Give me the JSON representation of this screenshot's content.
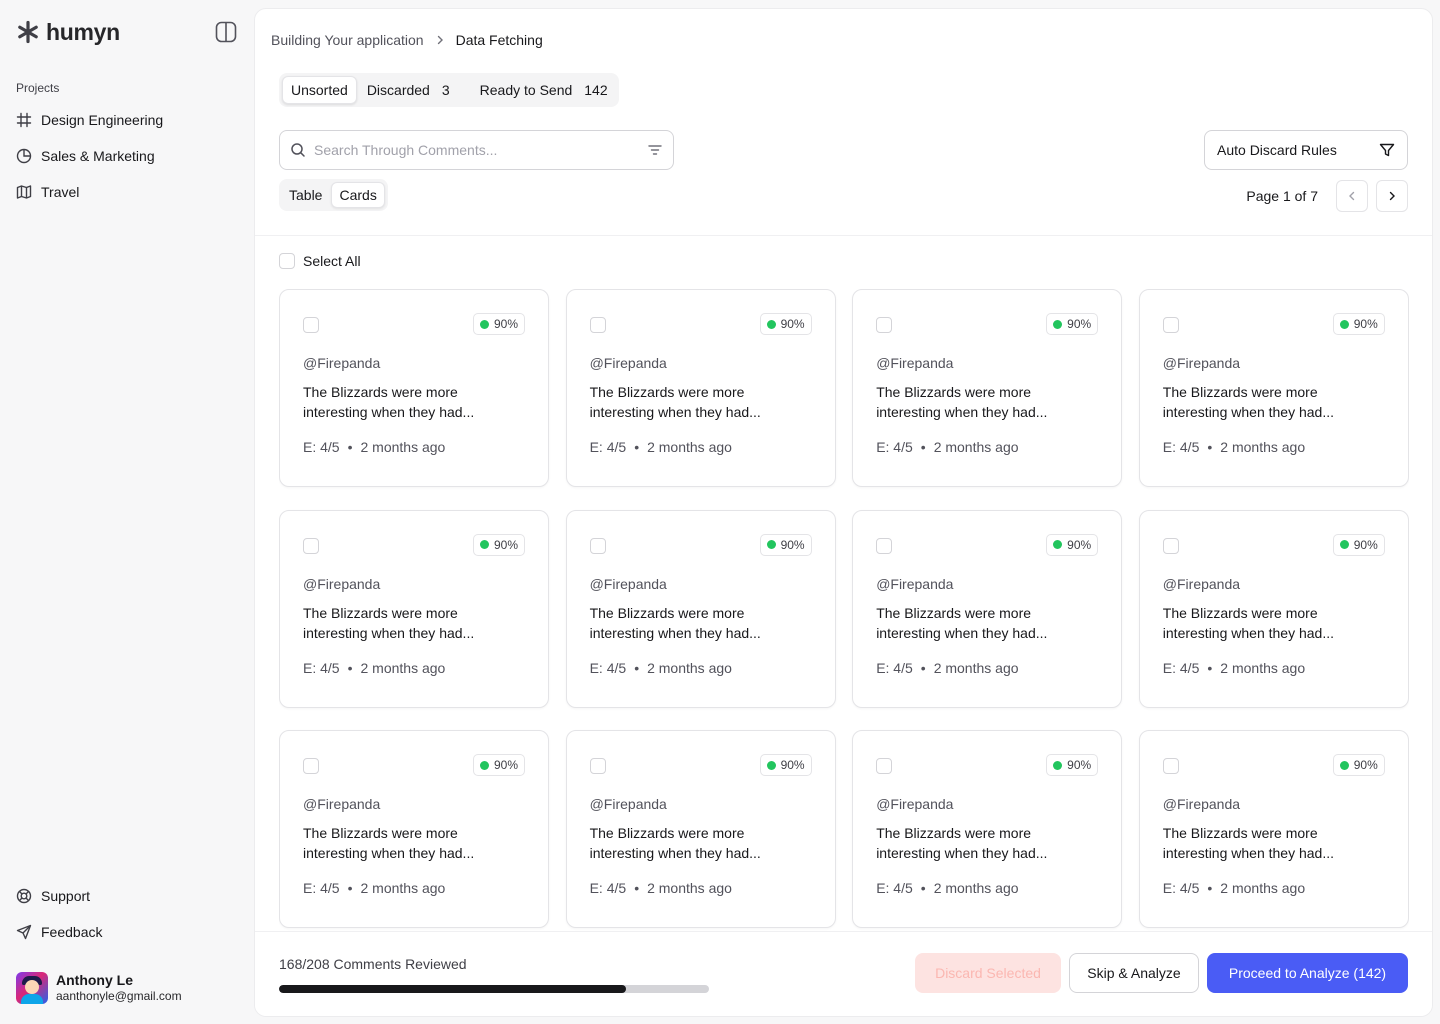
{
  "app": {
    "name": "humyn"
  },
  "sidebar": {
    "section_label": "Projects",
    "projects": [
      {
        "label": "Design Engineering",
        "icon": "hash-icon"
      },
      {
        "label": "Sales & Marketing",
        "icon": "pie-chart-icon"
      },
      {
        "label": "Travel",
        "icon": "map-icon"
      }
    ],
    "bottom": [
      {
        "label": "Support",
        "icon": "lifebuoy-icon"
      },
      {
        "label": "Feedback",
        "icon": "send-icon"
      }
    ],
    "user": {
      "name": "Anthony Le",
      "email": "aanthonyle@gmail.com"
    }
  },
  "breadcrumb": {
    "parent": "Building Your application",
    "current": "Data Fetching"
  },
  "status_tabs": [
    {
      "label": "Unsorted",
      "count": ""
    },
    {
      "label": "Discarded",
      "count": "3"
    },
    {
      "label": "Ready to Send",
      "count": "142"
    }
  ],
  "search": {
    "placeholder": "Search Through Comments...",
    "value": ""
  },
  "auto_discard": {
    "label": "Auto Discard Rules"
  },
  "view_tabs": [
    "Table",
    "Cards"
  ],
  "active_view": "Cards",
  "pagination": {
    "label": "Page 1 of 7",
    "current": 1,
    "total": 7
  },
  "select_all_label": "Select All",
  "cards": [
    {
      "score": "90%",
      "handle": "@Firepanda",
      "text": "The Blizzards were more interesting when they had...",
      "engagement": "E: 4/5",
      "time": "2 months ago"
    },
    {
      "score": "90%",
      "handle": "@Firepanda",
      "text": "The Blizzards were more interesting when they had...",
      "engagement": "E: 4/5",
      "time": "2 months ago"
    },
    {
      "score": "90%",
      "handle": "@Firepanda",
      "text": "The Blizzards were more interesting when they had...",
      "engagement": "E: 4/5",
      "time": "2 months ago"
    },
    {
      "score": "90%",
      "handle": "@Firepanda",
      "text": "The Blizzards were more interesting when they had...",
      "engagement": "E: 4/5",
      "time": "2 months ago"
    },
    {
      "score": "90%",
      "handle": "@Firepanda",
      "text": "The Blizzards were more interesting when they had...",
      "engagement": "E: 4/5",
      "time": "2 months ago"
    },
    {
      "score": "90%",
      "handle": "@Firepanda",
      "text": "The Blizzards were more interesting when they had...",
      "engagement": "E: 4/5",
      "time": "2 months ago"
    },
    {
      "score": "90%",
      "handle": "@Firepanda",
      "text": "The Blizzards were more interesting when they had...",
      "engagement": "E: 4/5",
      "time": "2 months ago"
    },
    {
      "score": "90%",
      "handle": "@Firepanda",
      "text": "The Blizzards were more interesting when they had...",
      "engagement": "E: 4/5",
      "time": "2 months ago"
    },
    {
      "score": "90%",
      "handle": "@Firepanda",
      "text": "The Blizzards were more interesting when they had...",
      "engagement": "E: 4/5",
      "time": "2 months ago"
    },
    {
      "score": "90%",
      "handle": "@Firepanda",
      "text": "The Blizzards were more interesting when they had...",
      "engagement": "E: 4/5",
      "time": "2 months ago"
    },
    {
      "score": "90%",
      "handle": "@Firepanda",
      "text": "The Blizzards were more interesting when they had...",
      "engagement": "E: 4/5",
      "time": "2 months ago"
    },
    {
      "score": "90%",
      "handle": "@Firepanda",
      "text": "The Blizzards were more interesting when they had...",
      "engagement": "E: 4/5",
      "time": "2 months ago"
    }
  ],
  "footer": {
    "reviewed_label": "168/208 Comments Reviewed",
    "reviewed": 168,
    "total": 208,
    "discard_label": "Discard Selected",
    "skip_label": "Skip & Analyze",
    "proceed_label": "Proceed to Analyze (142)"
  },
  "colors": {
    "accent": "#4a5cf5",
    "score_dot": "#22c55e",
    "discard_bg": "#fde3e1",
    "progress_fill": "#18181b"
  }
}
